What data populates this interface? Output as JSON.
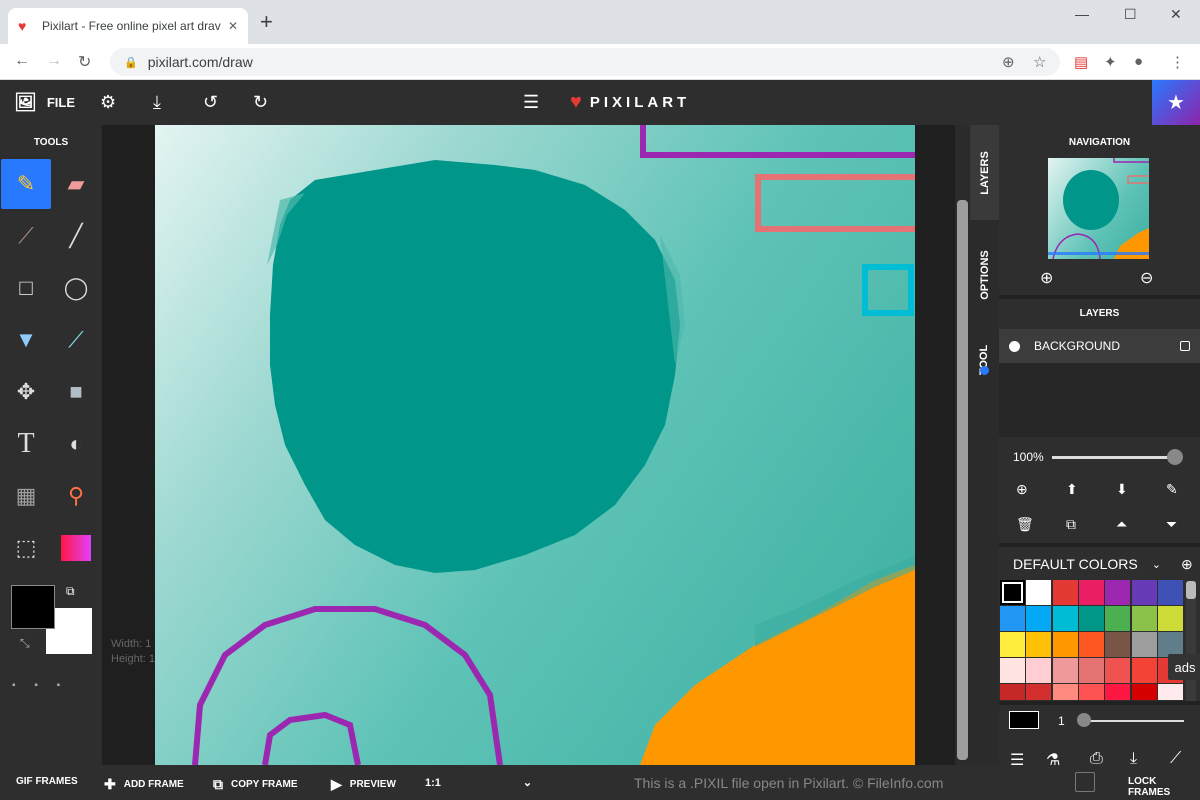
{
  "browser": {
    "tab_title": "Pixilart - Free online pixel art drav",
    "favicon": "heart-icon",
    "url": "pixilart.com/draw"
  },
  "header": {
    "file_label": "FILE",
    "logo_text": "PIXILART"
  },
  "tools": {
    "title": "TOOLS",
    "items": [
      "pencil",
      "eraser",
      "brush",
      "line",
      "rectangle",
      "circle",
      "bucket",
      "eyedropper",
      "move",
      "select",
      "text",
      "dither",
      "pattern",
      "stamp",
      "crop",
      "gradient"
    ],
    "active": "pencil",
    "primary_color": "#000000",
    "secondary_color": "#ffffff",
    "dims_width": "Width: 1",
    "dims_height": "Height: 1"
  },
  "side_tabs": {
    "layers": "LAYERS",
    "options": "OPTIONS",
    "tool": "TOOL"
  },
  "navigation": {
    "title": "NAVIGATION"
  },
  "layers": {
    "title": "LAYERS",
    "items": [
      {
        "label": "BACKGROUND"
      }
    ],
    "opacity": "100%"
  },
  "colors": {
    "title": "DEFAULT COLORS",
    "palette": [
      "#000000",
      "#ffffff",
      "#e53935",
      "#e91e63",
      "#9c27b0",
      "#673ab7",
      "#3f51b5",
      "#2196f3",
      "#03a9f4",
      "#00bcd4",
      "#009688",
      "#4caf50",
      "#8bc34a",
      "#cddc39",
      "#ffeb3b",
      "#ffc107",
      "#ff9800",
      "#ff5722",
      "#795548",
      "#9e9e9e",
      "#607d8b",
      "#ffe4e1",
      "#ffcdd2",
      "#ef9a9a",
      "#e57373",
      "#ef5350",
      "#f44336",
      "#e53935",
      "#c62828",
      "#d32f2f",
      "#ff8a80",
      "#ff5252",
      "#ff1744",
      "#d50000",
      "#ffebee"
    ],
    "brush_size": "1",
    "ads_label": "ads"
  },
  "bottom": {
    "gif_frames": "GIF FRAMES",
    "add_frame": "ADD FRAME",
    "copy_frame": "COPY FRAME",
    "preview": "PREVIEW",
    "ratio": "1:1",
    "watermark": "This is a .PIXIL file open in Pixilart. © FileInfo.com",
    "lock_frames": "LOCK FRAMES"
  }
}
